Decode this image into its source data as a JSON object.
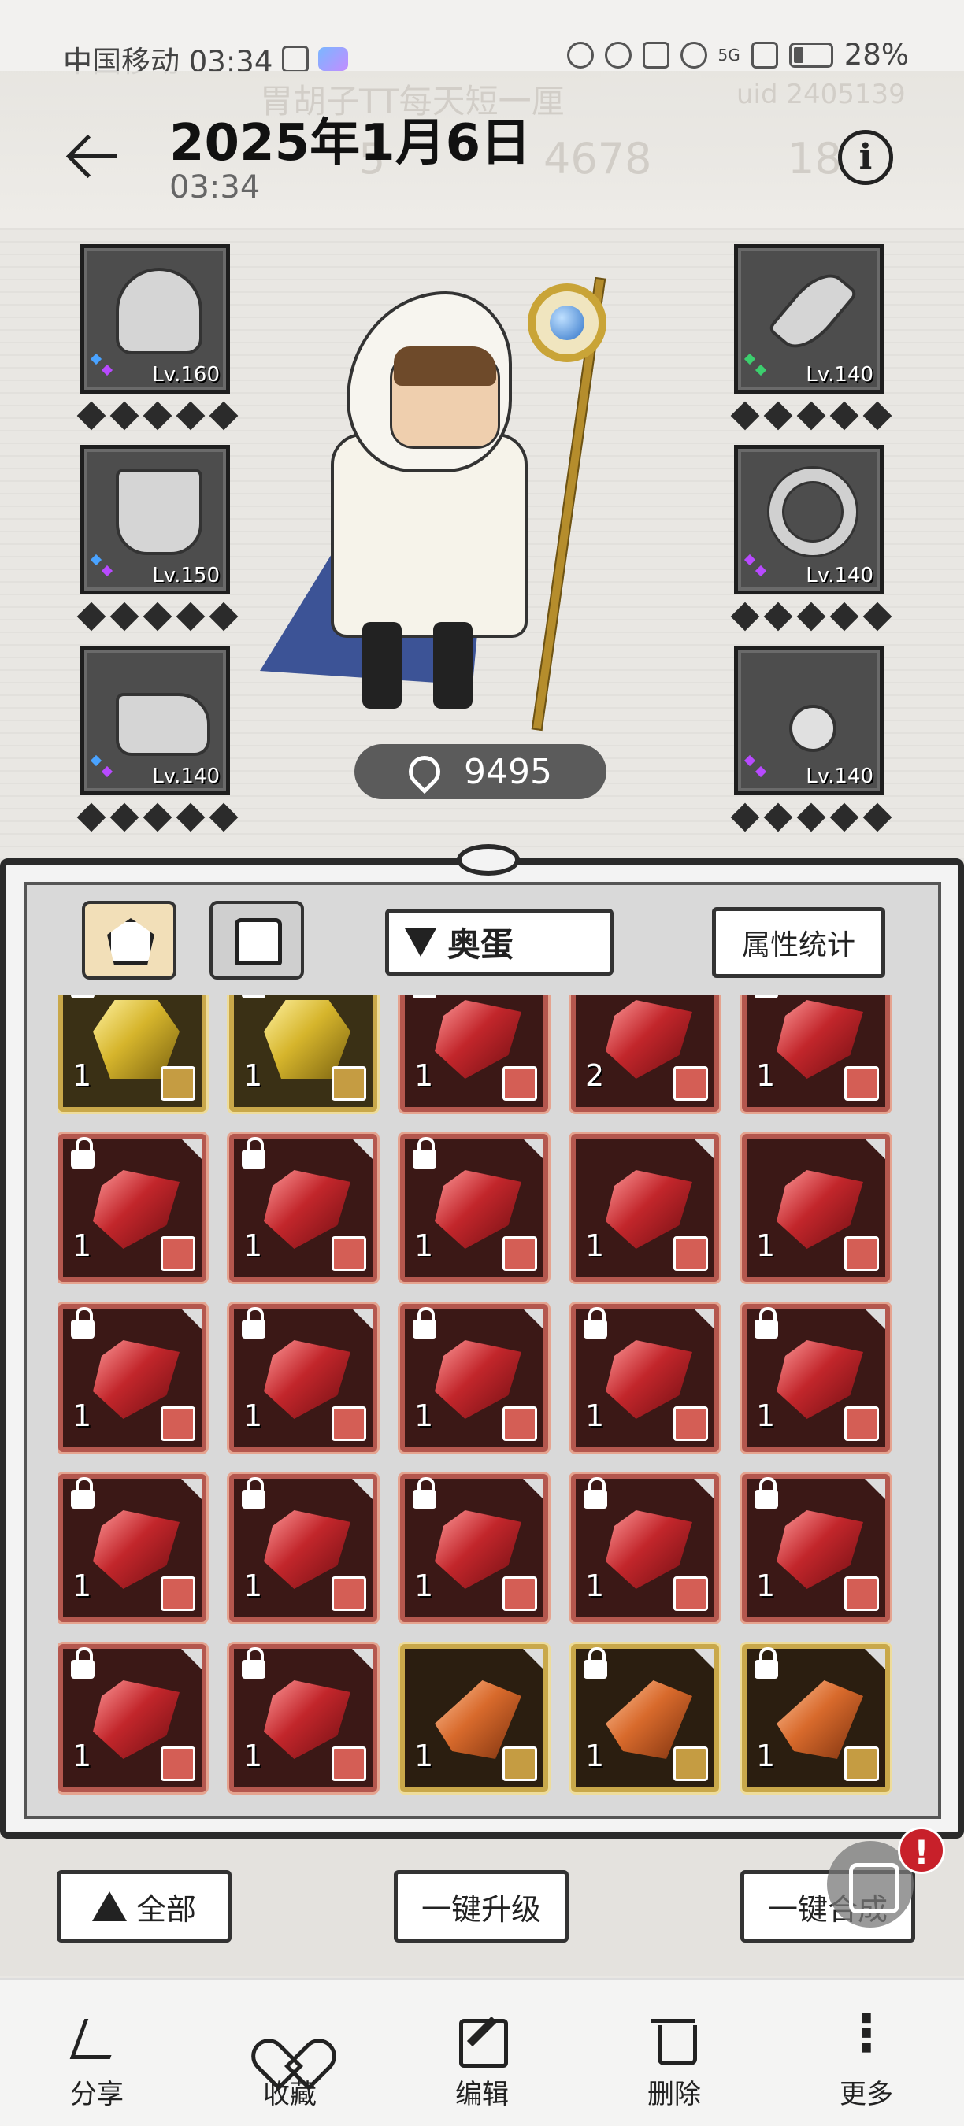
{
  "status_bar": {
    "carrier_time": "中国移动 03:34",
    "network": "5G",
    "battery": "28%"
  },
  "background": {
    "ghost_name": "胃胡子TT每天短一厘",
    "ghost_uid": "uid 2405139",
    "ghost_num1": "5",
    "ghost_num2": "4678",
    "ghost_num3": "18"
  },
  "header": {
    "title": "2025年1月6日",
    "subtitle": "03:34",
    "info_icon_label": "i"
  },
  "equipment": {
    "left": [
      {
        "name": "hood",
        "level": "Lv.160"
      },
      {
        "name": "cape",
        "level": "Lv.150"
      },
      {
        "name": "boots",
        "level": "Lv.140"
      }
    ],
    "right": [
      {
        "name": "horn",
        "level": "Lv.140"
      },
      {
        "name": "ring",
        "level": "Lv.140"
      },
      {
        "name": "amulet",
        "level": "Lv.140"
      }
    ],
    "power": "9495"
  },
  "inventory": {
    "filter_label": "奥蛋",
    "stats_button": "属性统计",
    "items": [
      {
        "kind": "gold",
        "count": "1",
        "locked": true
      },
      {
        "kind": "gold",
        "count": "1",
        "locked": true
      },
      {
        "kind": "red",
        "count": "1",
        "locked": true
      },
      {
        "kind": "red",
        "count": "2",
        "locked": false
      },
      {
        "kind": "red",
        "count": "1",
        "locked": true
      },
      {
        "kind": "red",
        "count": "1",
        "locked": true
      },
      {
        "kind": "red",
        "count": "1",
        "locked": true
      },
      {
        "kind": "red",
        "count": "1",
        "locked": true
      },
      {
        "kind": "red",
        "count": "1",
        "locked": false
      },
      {
        "kind": "red",
        "count": "1",
        "locked": false
      },
      {
        "kind": "red",
        "count": "1",
        "locked": true
      },
      {
        "kind": "red",
        "count": "1",
        "locked": true
      },
      {
        "kind": "red",
        "count": "1",
        "locked": true
      },
      {
        "kind": "red",
        "count": "1",
        "locked": true
      },
      {
        "kind": "red",
        "count": "1",
        "locked": true
      },
      {
        "kind": "red",
        "count": "1",
        "locked": true
      },
      {
        "kind": "red",
        "count": "1",
        "locked": true
      },
      {
        "kind": "red",
        "count": "1",
        "locked": true
      },
      {
        "kind": "red",
        "count": "1",
        "locked": true
      },
      {
        "kind": "red",
        "count": "1",
        "locked": true
      },
      {
        "kind": "red",
        "count": "1",
        "locked": true
      },
      {
        "kind": "red",
        "count": "1",
        "locked": true
      },
      {
        "kind": "orange",
        "count": "1",
        "locked": false
      },
      {
        "kind": "orange",
        "count": "1",
        "locked": true
      },
      {
        "kind": "orange",
        "count": "1",
        "locked": true
      }
    ]
  },
  "game_buttons": {
    "all_label": "全部",
    "upgrade_label": "一键升级",
    "merge_label": "一键合成",
    "badge": "!"
  },
  "toolbar": {
    "share": "分享",
    "favorite": "收藏",
    "edit": "编辑",
    "delete": "删除",
    "more": "更多"
  },
  "colors": {
    "gem_red": "#c2262b",
    "gem_gold": "#d6b52c",
    "gem_orange": "#d86a2c",
    "alert_red": "#c8202a"
  }
}
